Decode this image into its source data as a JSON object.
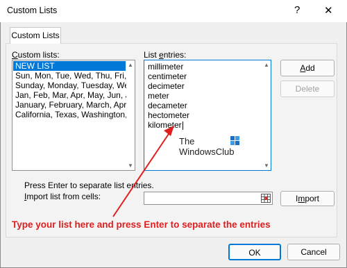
{
  "window": {
    "title": "Custom Lists",
    "help_glyph": "?",
    "close_glyph": "✕"
  },
  "tab": {
    "label": "Custom Lists"
  },
  "custom_lists": {
    "label_u": "C",
    "label_rest": "ustom lists:",
    "items": [
      "NEW LIST",
      "Sun, Mon, Tue, Wed, Thu, Fri,",
      "Sunday, Monday, Tuesday, We",
      "Jan, Feb, Mar, Apr, May, Jun, Ju",
      "January, February, March, Apri",
      "California, Texas, Washington,"
    ],
    "selected_index": 0
  },
  "list_entries": {
    "label_pre": "List ",
    "label_u": "e",
    "label_rest": "ntries:",
    "items": [
      "millimeter",
      "centimeter",
      "decimeter",
      "meter",
      "decameter",
      "hectometer",
      "kilometer"
    ]
  },
  "buttons": {
    "add_u": "A",
    "add_rest": "dd",
    "delete": "Delete",
    "import_pre": "I",
    "import_u": "m",
    "import_rest": "port",
    "ok": "OK",
    "cancel": "Cancel"
  },
  "hint": "Press Enter to separate list entries.",
  "import_label": {
    "label_u": "I",
    "label_rest": "mport list from cells:",
    "value": ""
  },
  "watermark": {
    "line1": "The",
    "line2": "WindowsClub"
  },
  "annotation": {
    "text": "Type your list here and press Enter to separate the entries",
    "color": "#e01e1e"
  },
  "icons": {
    "scroll_up": "▲",
    "scroll_down": "▼",
    "range_picker": "range-select-icon"
  },
  "colors": {
    "selection": "#0078d7",
    "accent_border": "#0078d7"
  }
}
